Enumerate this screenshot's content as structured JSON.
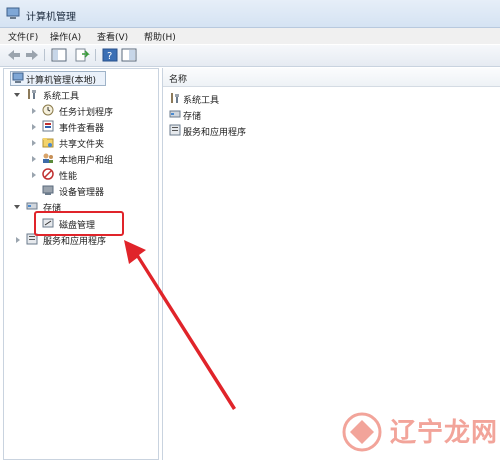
{
  "window": {
    "title": "计算机管理"
  },
  "menu": [
    {
      "label": "文件(F)"
    },
    {
      "label": "操作(A)"
    },
    {
      "label": "查看(V)"
    },
    {
      "label": "帮助(H)"
    }
  ],
  "toolbar": {
    "icons": [
      "back-icon",
      "forward-icon",
      "show-tree-icon",
      "export-icon",
      "help-icon",
      "properties-icon"
    ]
  },
  "tree": {
    "root": "计算机管理(本地)",
    "system_tools": "系统工具",
    "task_scheduler": "任务计划程序",
    "event_viewer": "事件查看器",
    "shared_folders": "共享文件夹",
    "local_users": "本地用户和组",
    "performance": "性能",
    "device_manager": "设备管理器",
    "storage": "存储",
    "disk_management": "磁盘管理",
    "services_apps": "服务和应用程序"
  },
  "list": {
    "column_name": "名称",
    "items": [
      "系统工具",
      "存储",
      "服务和应用程序"
    ]
  },
  "annotation": {
    "color": "#e0242a"
  },
  "watermark": {
    "text": "辽宁龙网"
  }
}
